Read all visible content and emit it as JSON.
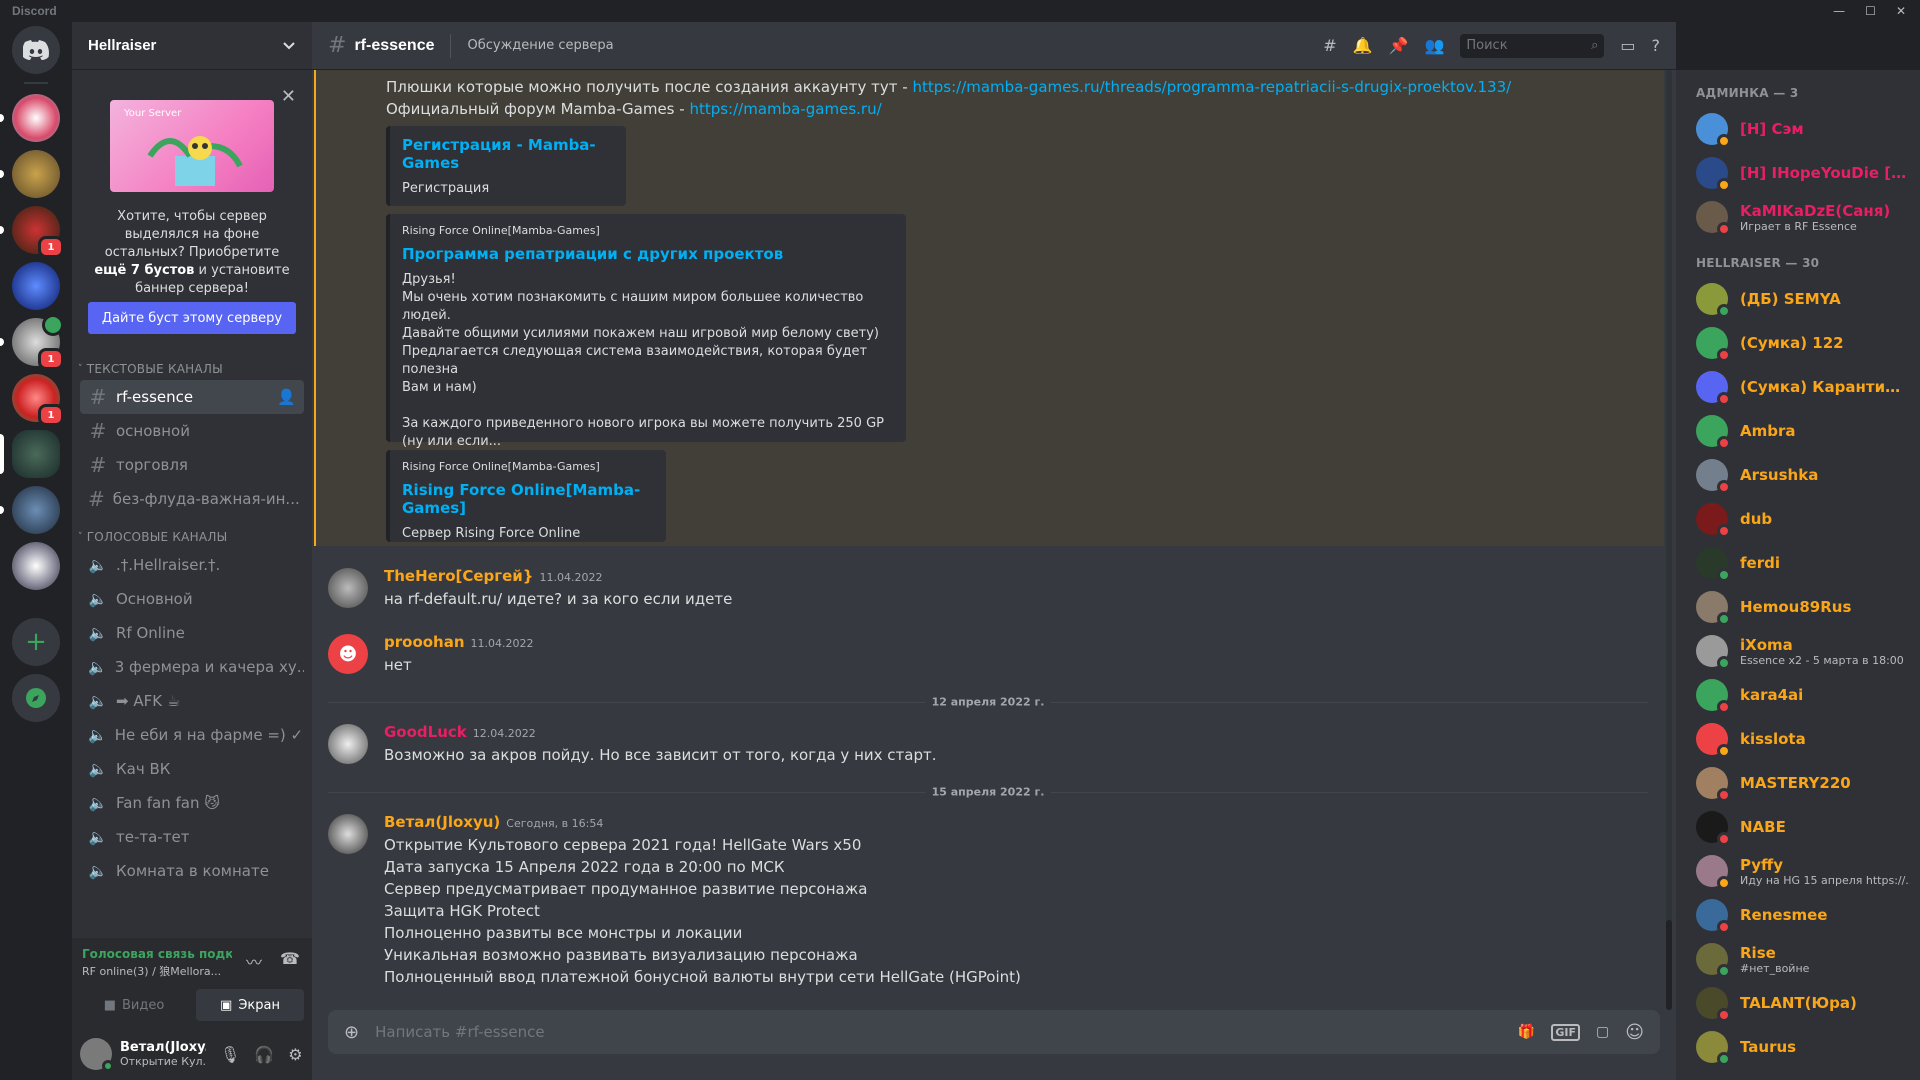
{
  "app": {
    "title": "Discord",
    "window_controls": [
      "—",
      "☐",
      "✕"
    ]
  },
  "server": {
    "name": "Hellraiser"
  },
  "boost": {
    "art_label": "Your Server",
    "text_before": "Хотите, чтобы сервер выделялся на фоне остальных? Приобретите ",
    "text_bold": "ещё 7 бустов",
    "text_after": " и установите баннер сервера!",
    "button": "Дайте буст этому серверу"
  },
  "guild_badges": [
    "1",
    "1",
    "1"
  ],
  "categories": {
    "text": "ТЕКСТОВЫЕ КАНАЛЫ",
    "voice": "ГОЛОСОВЫЕ КАНАЛЫ"
  },
  "text_channels": [
    {
      "name": "rf-essence",
      "selected": true
    },
    {
      "name": "основной"
    },
    {
      "name": "торговля"
    },
    {
      "name": "без-флуда-важная-ин..."
    }
  ],
  "voice_channels": [
    {
      "name": ".†.Hellraiser.†."
    },
    {
      "name": "Основной"
    },
    {
      "name": "Rf Online"
    },
    {
      "name": "3 фермера и качера ху..."
    },
    {
      "name": "➡ AFK ☕"
    },
    {
      "name": "Не еби я на фарме =) ✓"
    },
    {
      "name": "Кач ВК"
    },
    {
      "name": "Fan fan fan 😼"
    },
    {
      "name": "те-та-тет"
    },
    {
      "name": "Комната в комнате"
    }
  ],
  "voice_status": {
    "title": "Голосовая связь подк",
    "subtitle": "RF online(3) / 狼Mellora...",
    "video": "Видео",
    "screen": "Экран"
  },
  "user": {
    "name": "Ветал(Jloxy...",
    "status": "Открытие Кул..."
  },
  "channel": {
    "name": "rf-essence",
    "topic": "Обсуждение сервера"
  },
  "search": {
    "placeholder": "Поиск"
  },
  "pinned": {
    "line1_text": "Плюшки которые можно получить после создания аккаунту  тут - ",
    "line1_link": "https://mamba-games.ru/threads/programma-repatriacii-s-drugix-proektov.133/",
    "line2_text": "Официальный форум Mamba-Games - ",
    "line2_link": "https://mamba-games.ru/",
    "embeds": [
      {
        "provider": "",
        "title": "Регистрация - Mamba-Games",
        "desc": "Регистрация"
      },
      {
        "provider": "Rising Force Online[Mamba-Games]",
        "title": "Программа репатриации с других проектов",
        "desc": "Друзья!\nМы очень хотим познакомить с нашим миром большее количество людей.\nДавайте общими усилиями покажем наш игровой мир белому свету)\nПредлагается следующая система взаимодействия, которая будет полезна\nВам и нам)\n\nЗа каждого приведенного нового игрока вы можете получить 250 GP\n(ну или если..."
      },
      {
        "provider": "Rising Force Online[Mamba-Games]",
        "title": "Rising Force Online[Mamba-Games]",
        "desc": "Сервер Rising Force Online"
      }
    ]
  },
  "messages": [
    {
      "author": "TheHero[Сергей}",
      "color": "#faa61a",
      "time": "11.04.2022",
      "lines": [
        "на rf-default.ru/ идете? и за кого если идете"
      ]
    },
    {
      "author": "prooohan",
      "color": "#faa61a",
      "time": "11.04.2022",
      "lines": [
        "нет"
      ]
    },
    {
      "author": "GoodLuck",
      "color": "#e91e63",
      "time": "12.04.2022",
      "lines": [
        "Возможно за акров пойду. Но все зависит от того, когда у них старт."
      ]
    },
    {
      "author": "Ветал(Jloxyu)",
      "color": "#faa61a",
      "time": "Сегодня, в 16:54",
      "lines": [
        "Открытие Культового сервера 2021 года! HellGate Wars x50",
        "Дата запуска 15 Апреля 2022 года в 20:00 по МСК",
        "Сервер предусматривает продуманное развитие персонажа",
        "Защита HGK Protect",
        "Полноценно развиты все монстры и локации",
        "Уникальная возможно развивать визуализацию персонажа",
        "Полноценный ввод платежной бонусной валюты внутри сети HellGate (HGPoint)"
      ]
    }
  ],
  "date_separators": [
    "12 апреля 2022 г.",
    "15 апреля 2022 г."
  ],
  "composer": {
    "placeholder": "Написать #rf-essence",
    "gif": "GIF"
  },
  "member_groups": [
    {
      "title": "АДМИНКА — 3",
      "members": [
        {
          "name": "[H] Сэм",
          "color": "#e91e63",
          "status": "#faa61a"
        },
        {
          "name": "[H] IHopeYouDie [Vov...",
          "color": "#e91e63",
          "status": "#faa61a"
        },
        {
          "name": "KaMIKaDzE(Саня)",
          "color": "#e91e63",
          "status": "#ed4245",
          "activity": "Играет в RF Essence"
        }
      ]
    },
    {
      "title": "HELLRAISER — 30",
      "members": [
        {
          "name": "(ДБ) SEMYA",
          "color": "#faa61a",
          "status": "#3ba55d"
        },
        {
          "name": "(Сумка) 122",
          "color": "#faa61a",
          "status": "#ed4245"
        },
        {
          "name": "(Сумка) Карантин (д...",
          "color": "#faa61a",
          "status": "#ed4245"
        },
        {
          "name": "Ambra",
          "color": "#faa61a",
          "status": "#ed4245"
        },
        {
          "name": "Arsushka",
          "color": "#faa61a",
          "status": "#ed4245"
        },
        {
          "name": "dub",
          "color": "#faa61a",
          "status": "#ed4245"
        },
        {
          "name": "ferdi",
          "color": "#faa61a",
          "status": "#3ba55d"
        },
        {
          "name": "Hemou89Rus",
          "color": "#faa61a",
          "status": "#3ba55d"
        },
        {
          "name": "iXoma",
          "color": "#faa61a",
          "status": "#3ba55d",
          "activity": "Essence x2 - 5 марта в 18:00"
        },
        {
          "name": "kara4ai",
          "color": "#faa61a",
          "status": "#ed4245"
        },
        {
          "name": "kisslota",
          "color": "#faa61a",
          "status": "#faa61a"
        },
        {
          "name": "MASTERY220",
          "color": "#faa61a",
          "status": "#ed4245"
        },
        {
          "name": "NABE",
          "color": "#faa61a",
          "status": "#ed4245"
        },
        {
          "name": "Pyffy",
          "color": "#faa61a",
          "status": "#faa61a",
          "activity": "Иду на HG 15 апреля https://..."
        },
        {
          "name": "Renesmee",
          "color": "#faa61a",
          "status": "#ed4245"
        },
        {
          "name": "Rise",
          "color": "#faa61a",
          "status": "#3ba55d",
          "activity": "#нет_войне"
        },
        {
          "name": "TALANT(Юра)",
          "color": "#faa61a",
          "status": "#ed4245"
        },
        {
          "name": "Taurus",
          "color": "#faa61a",
          "status": "#3ba55d"
        }
      ]
    }
  ]
}
